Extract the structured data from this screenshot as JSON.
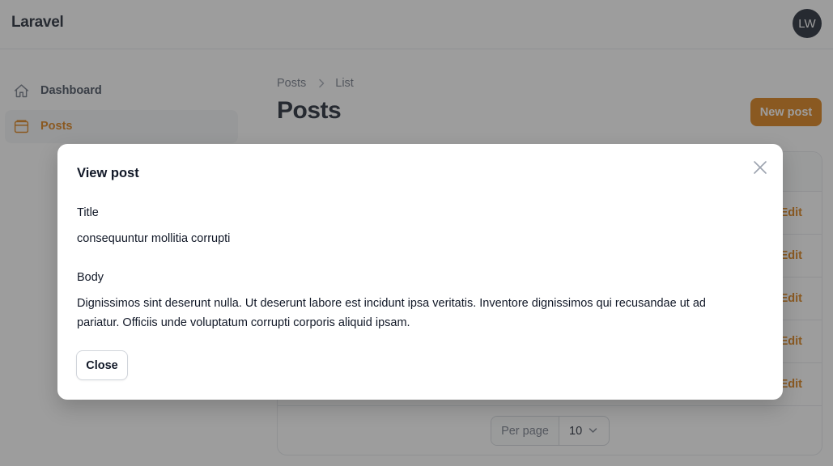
{
  "header": {
    "brand": "Laravel",
    "avatar_initials": "LW"
  },
  "sidebar": {
    "items": [
      {
        "label": "Dashboard",
        "icon": "home-icon",
        "active": false
      },
      {
        "label": "Posts",
        "icon": "archive-icon",
        "active": true
      }
    ]
  },
  "main": {
    "breadcrumb": [
      "Posts",
      "List"
    ],
    "title": "Posts",
    "new_button": "New post",
    "table": {
      "rows": [
        {
          "action": "Edit"
        },
        {
          "action": "Edit"
        },
        {
          "action": "Edit"
        },
        {
          "action": "Edit"
        },
        {
          "action": "Edit"
        }
      ]
    },
    "pagination": {
      "per_page_label": "Per page",
      "per_page_value": "10"
    }
  },
  "modal": {
    "title": "View post",
    "fields": [
      {
        "label": "Title",
        "value": "consequuntur mollitia corrupti"
      },
      {
        "label": "Body",
        "value": "Dignissimos sint deserunt nulla. Ut deserunt labore est incidunt ipsa veritatis. Inventore dignissimos qui recusandae ut ad pariatur. Officiis unde voluptatum corrupti corporis aliquid ipsam."
      }
    ],
    "close_label": "Close"
  },
  "colors": {
    "primary": "#d97706",
    "overlay": "rgba(60,60,60,0.5)"
  }
}
